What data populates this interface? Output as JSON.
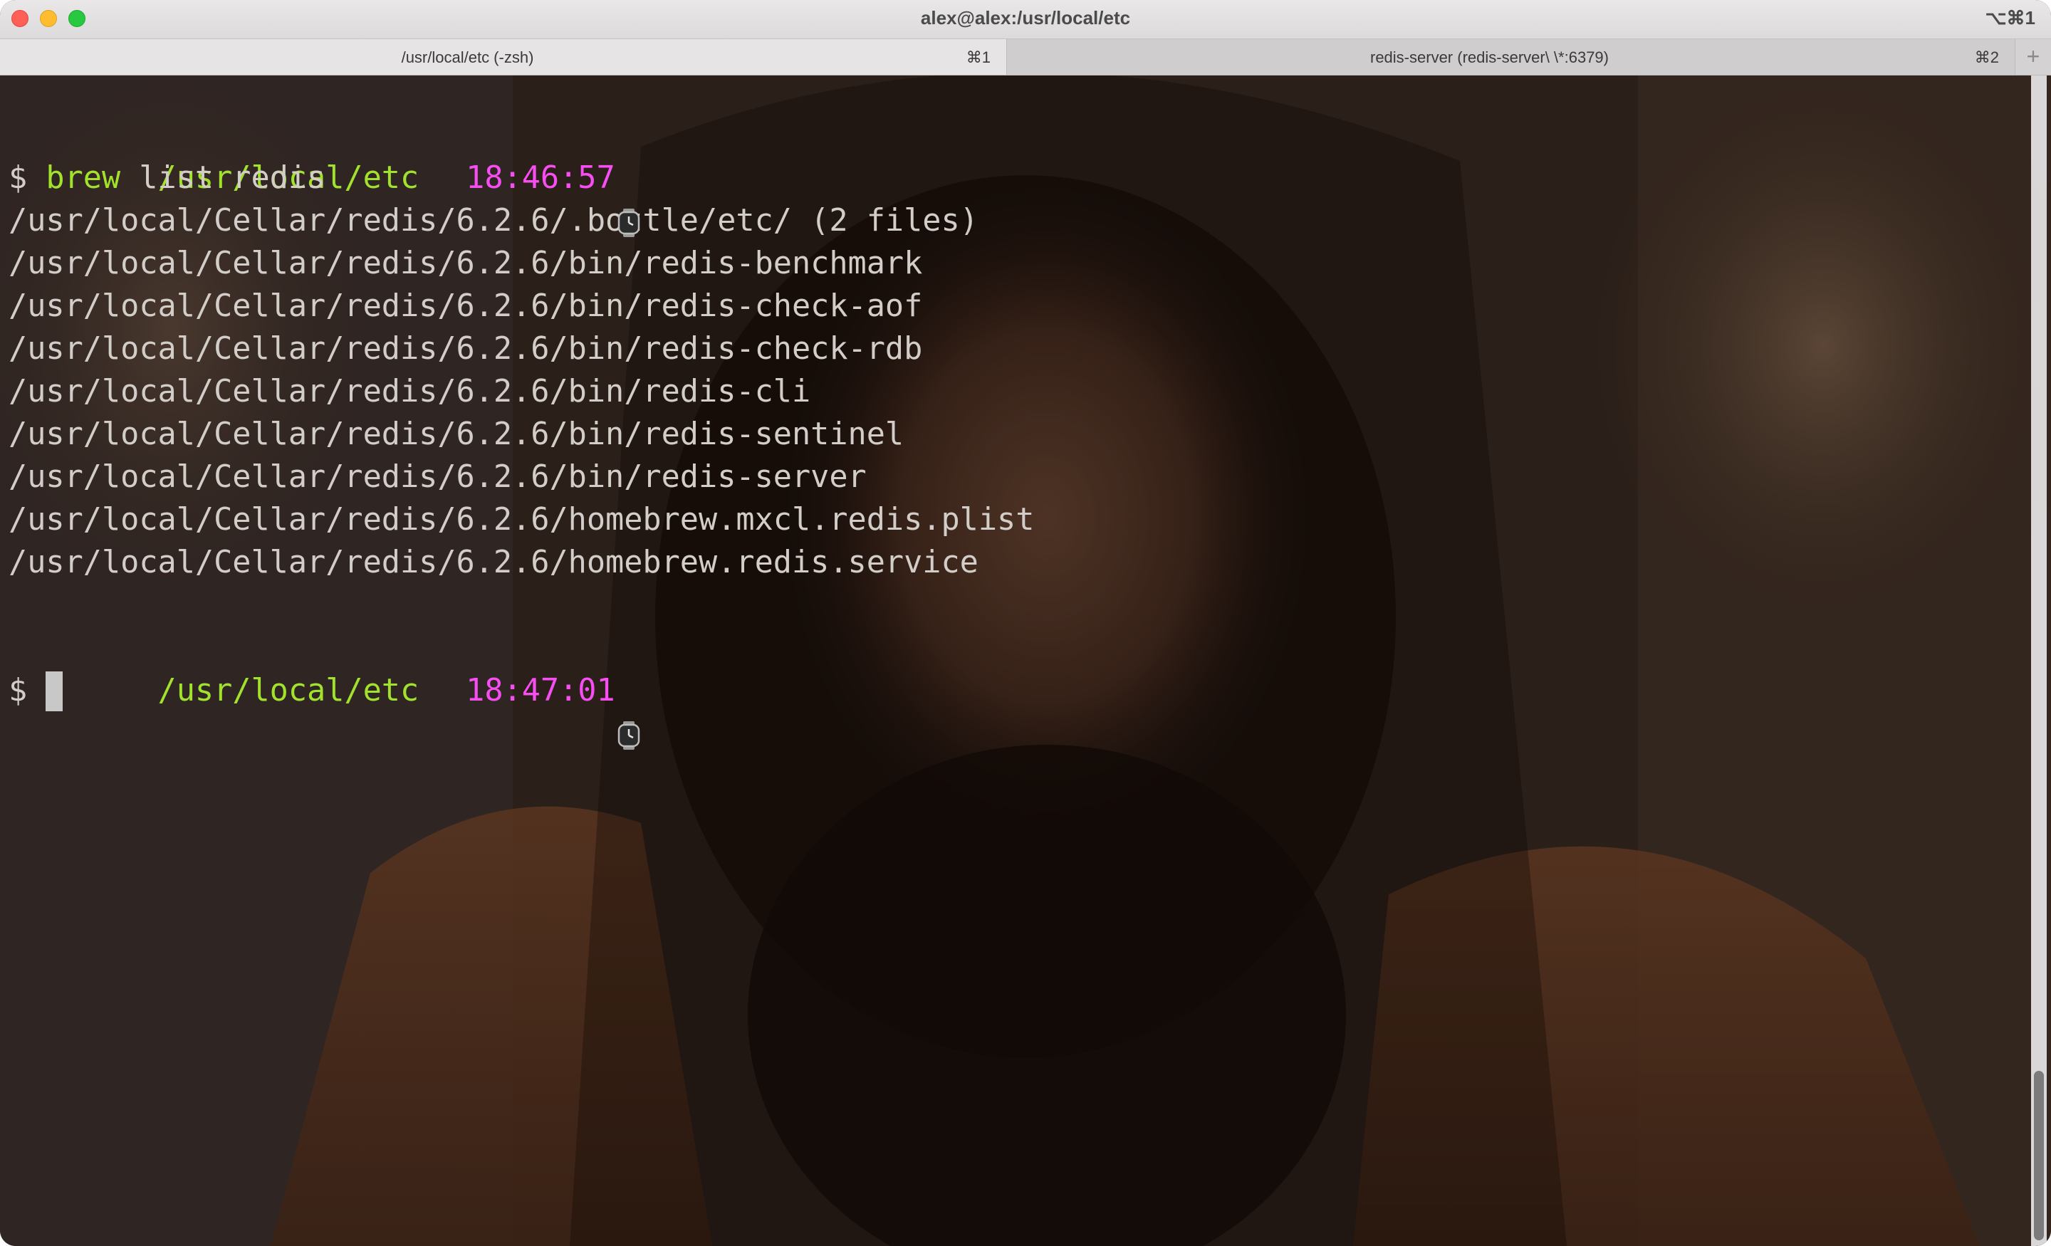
{
  "window": {
    "title": "alex@alex:/usr/local/etc",
    "shortcut": "⌥⌘1"
  },
  "tabs": [
    {
      "label": "/usr/local/etc (-zsh)",
      "key": "⌘1",
      "active": true
    },
    {
      "label": "redis-server (redis-server\\ \\*:6379)",
      "key": "⌘2",
      "active": false
    }
  ],
  "new_tab_symbol": "+",
  "terminal": {
    "prompt1": {
      "path": "/usr/local/etc",
      "time": "18:46:57",
      "symbol": "$",
      "command": "brew",
      "args": " list redis"
    },
    "output": [
      "/usr/local/Cellar/redis/6.2.6/.bottle/etc/ (2 files)",
      "/usr/local/Cellar/redis/6.2.6/bin/redis-benchmark",
      "/usr/local/Cellar/redis/6.2.6/bin/redis-check-aof",
      "/usr/local/Cellar/redis/6.2.6/bin/redis-check-rdb",
      "/usr/local/Cellar/redis/6.2.6/bin/redis-cli",
      "/usr/local/Cellar/redis/6.2.6/bin/redis-sentinel",
      "/usr/local/Cellar/redis/6.2.6/bin/redis-server",
      "/usr/local/Cellar/redis/6.2.6/homebrew.mxcl.redis.plist",
      "/usr/local/Cellar/redis/6.2.6/homebrew.redis.service"
    ],
    "prompt2": {
      "path": "/usr/local/etc",
      "time": "18:47:01",
      "symbol": "$"
    },
    "icons": {
      "clock": "watch-icon"
    },
    "colors": {
      "path": "#a2e22d",
      "time": "#f74ef1",
      "text": "#d2cdc8",
      "command": "#a2e22d"
    }
  },
  "scroll_position": 0.92
}
